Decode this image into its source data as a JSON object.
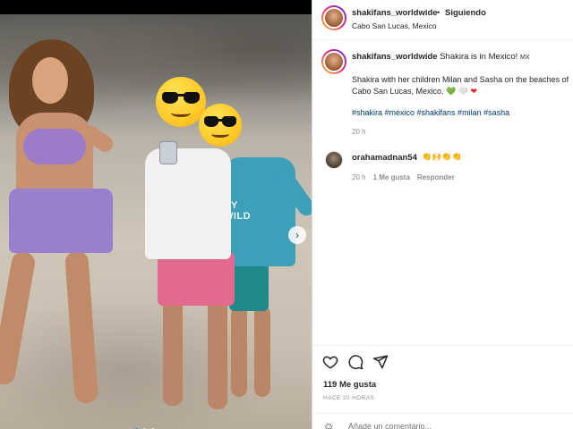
{
  "post": {
    "username": "shakifans_worldwide",
    "follow_status": "Siguiendo",
    "location": "Cabo San Lucas, Mexico",
    "caption_title": "Shakira is in Mexico!",
    "caption_flag": "MX",
    "caption_body": "Shakira with her children Milan and Sasha on the beaches of Cabo San Lucas, Mexico.",
    "caption_hearts": [
      "💚",
      "🤍",
      "❤"
    ],
    "hashtags": "#shakira #mexico #shakifans #milan #sasha",
    "caption_time": "20 h"
  },
  "photo": {
    "shirt_print": "RY\nWILD",
    "carousel_next_icon": "chevron-right-icon",
    "carousel_dots": 3
  },
  "comment": {
    "username": "orahamadnan54",
    "emoji": "👏🙌👏👏",
    "time": "20 h",
    "likes": "1 Me gusta",
    "reply": "Responder"
  },
  "actions": {
    "icons": [
      "heart-icon",
      "comment-icon",
      "share-icon"
    ],
    "likes": "119 Me gusta",
    "ago": "HACE 20 HORAS",
    "comment_placeholder": "Añade un comentario..."
  },
  "colors": {
    "link": "#00376b",
    "muted": "#8e8e8e",
    "text": "#262626",
    "story_ring_start": "#f9ce34",
    "story_ring_end": "#6228d7"
  }
}
